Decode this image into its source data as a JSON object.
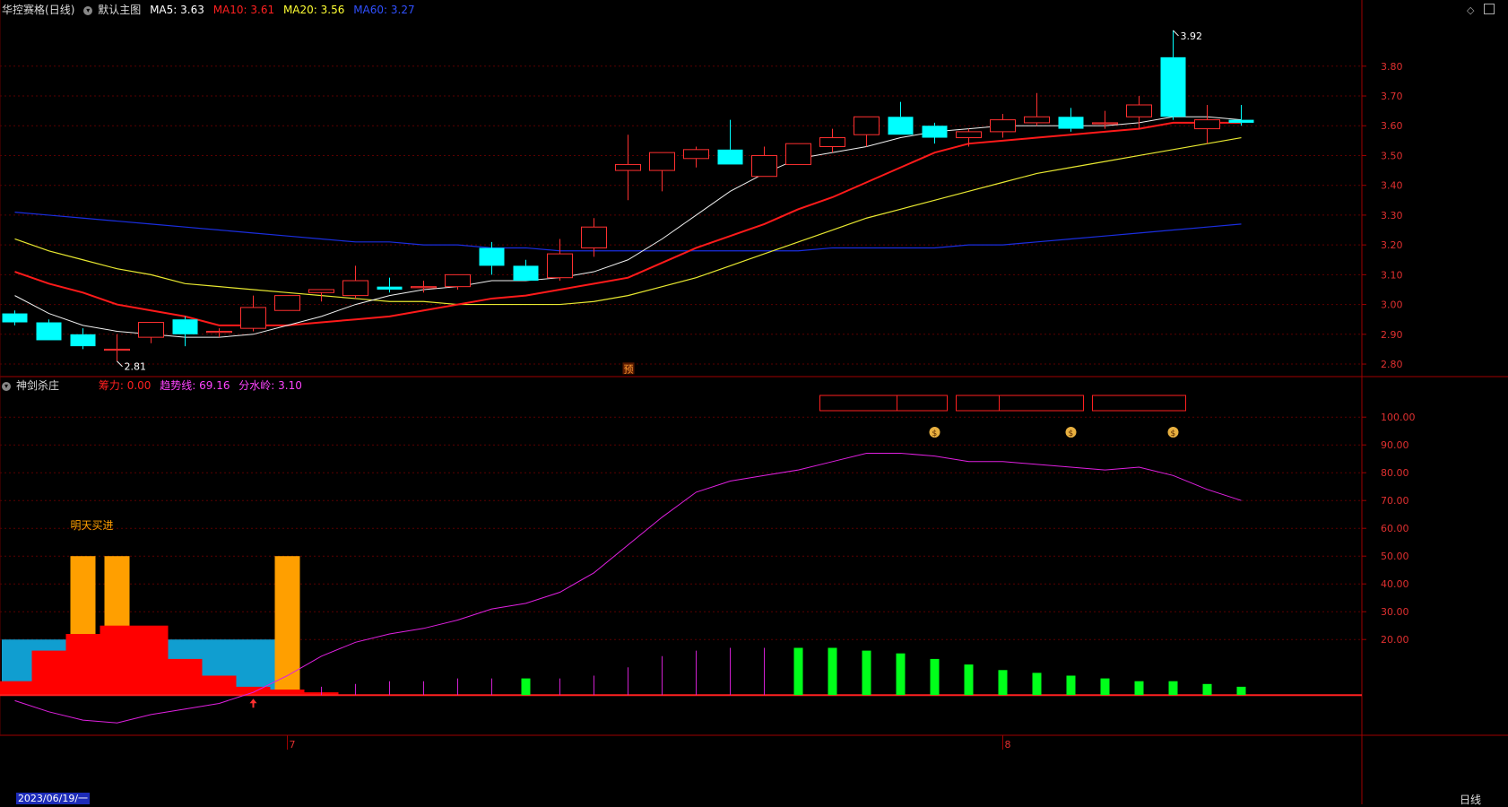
{
  "header": {
    "stock_name": "华控赛格",
    "period": "(日线)",
    "main_chart_label": "默认主图",
    "ma": [
      {
        "label": "MA5:",
        "value": "3.63",
        "color": "#ffffff"
      },
      {
        "label": "MA10:",
        "value": "3.61",
        "color": "#ff2020"
      },
      {
        "label": "MA20:",
        "value": "3.56",
        "color": "#ffff33"
      },
      {
        "label": "MA60:",
        "value": "3.27",
        "color": "#3050ff"
      }
    ]
  },
  "indicator_header": {
    "name": "神剑杀庄",
    "items": [
      {
        "text": "筹力: 0.00",
        "color": "#ff2020"
      },
      {
        "text": "趋势线: 69.16",
        "color": "#ff44ff"
      },
      {
        "text": "分水岭: 3.10",
        "color": "#ff44ff"
      }
    ]
  },
  "footer": {
    "date": "2023/06/19/一",
    "period_button": "日线",
    "month_marks": [
      "7",
      "8"
    ]
  },
  "chart_data": [
    {
      "type": "candlestick",
      "ylim": [
        2.77,
        3.98
      ],
      "y_ticks": [
        "3.80",
        "3.70",
        "3.60",
        "3.50",
        "3.40",
        "3.30",
        "3.20",
        "3.10",
        "3.00",
        "2.90",
        "2.80"
      ],
      "candles": [
        {
          "o": 2.97,
          "h": 2.98,
          "l": 2.93,
          "c": 2.94
        },
        {
          "o": 2.94,
          "h": 2.95,
          "l": 2.88,
          "c": 2.88
        },
        {
          "o": 2.9,
          "h": 2.92,
          "l": 2.85,
          "c": 2.86
        },
        {
          "o": 2.85,
          "h": 2.9,
          "l": 2.81,
          "c": 2.85
        },
        {
          "o": 2.89,
          "h": 2.94,
          "l": 2.87,
          "c": 2.94
        },
        {
          "o": 2.95,
          "h": 2.96,
          "l": 2.86,
          "c": 2.9
        },
        {
          "o": 2.91,
          "h": 2.92,
          "l": 2.89,
          "c": 2.91
        },
        {
          "o": 2.92,
          "h": 3.03,
          "l": 2.91,
          "c": 2.99
        },
        {
          "o": 2.98,
          "h": 3.03,
          "l": 2.98,
          "c": 3.03
        },
        {
          "o": 3.04,
          "h": 3.05,
          "l": 3.01,
          "c": 3.05
        },
        {
          "o": 3.03,
          "h": 3.13,
          "l": 3.02,
          "c": 3.08
        },
        {
          "o": 3.06,
          "h": 3.09,
          "l": 3.04,
          "c": 3.05
        },
        {
          "o": 3.06,
          "h": 3.08,
          "l": 3.04,
          "c": 3.06
        },
        {
          "o": 3.06,
          "h": 3.1,
          "l": 3.05,
          "c": 3.1
        },
        {
          "o": 3.19,
          "h": 3.21,
          "l": 3.1,
          "c": 3.13
        },
        {
          "o": 3.13,
          "h": 3.15,
          "l": 3.08,
          "c": 3.08
        },
        {
          "o": 3.09,
          "h": 3.22,
          "l": 3.08,
          "c": 3.17
        },
        {
          "o": 3.19,
          "h": 3.29,
          "l": 3.16,
          "c": 3.26
        },
        {
          "o": 3.45,
          "h": 3.57,
          "l": 3.35,
          "c": 3.47
        },
        {
          "o": 3.45,
          "h": 3.51,
          "l": 3.38,
          "c": 3.51
        },
        {
          "o": 3.49,
          "h": 3.53,
          "l": 3.46,
          "c": 3.52
        },
        {
          "o": 3.52,
          "h": 3.62,
          "l": 3.47,
          "c": 3.47
        },
        {
          "o": 3.43,
          "h": 3.53,
          "l": 3.43,
          "c": 3.5
        },
        {
          "o": 3.47,
          "h": 3.54,
          "l": 3.47,
          "c": 3.54
        },
        {
          "o": 3.53,
          "h": 3.59,
          "l": 3.51,
          "c": 3.56
        },
        {
          "o": 3.57,
          "h": 3.63,
          "l": 3.53,
          "c": 3.63
        },
        {
          "o": 3.63,
          "h": 3.68,
          "l": 3.57,
          "c": 3.57
        },
        {
          "o": 3.6,
          "h": 3.61,
          "l": 3.54,
          "c": 3.56
        },
        {
          "o": 3.56,
          "h": 3.59,
          "l": 3.53,
          "c": 3.58
        },
        {
          "o": 3.58,
          "h": 3.64,
          "l": 3.56,
          "c": 3.62
        },
        {
          "o": 3.61,
          "h": 3.71,
          "l": 3.6,
          "c": 3.63
        },
        {
          "o": 3.63,
          "h": 3.66,
          "l": 3.58,
          "c": 3.59
        },
        {
          "o": 3.61,
          "h": 3.65,
          "l": 3.59,
          "c": 3.61
        },
        {
          "o": 3.63,
          "h": 3.7,
          "l": 3.59,
          "c": 3.67
        },
        {
          "o": 3.83,
          "h": 3.92,
          "l": 3.62,
          "c": 3.63
        },
        {
          "o": 3.59,
          "h": 3.67,
          "l": 3.54,
          "c": 3.62
        },
        {
          "o": 3.62,
          "h": 3.67,
          "l": 3.6,
          "c": 3.61
        }
      ],
      "ma5": [
        3.03,
        2.97,
        2.93,
        2.91,
        2.9,
        2.89,
        2.89,
        2.9,
        2.93,
        2.96,
        3.0,
        3.03,
        3.05,
        3.06,
        3.08,
        3.08,
        3.09,
        3.11,
        3.15,
        3.22,
        3.3,
        3.38,
        3.44,
        3.49,
        3.51,
        3.53,
        3.56,
        3.58,
        3.59,
        3.6,
        3.6,
        3.6,
        3.6,
        3.61,
        3.63,
        3.63,
        3.62
      ],
      "ma10": [
        3.11,
        3.07,
        3.04,
        3.0,
        2.98,
        2.96,
        2.93,
        2.93,
        2.93,
        2.94,
        2.95,
        2.96,
        2.98,
        3.0,
        3.02,
        3.03,
        3.05,
        3.07,
        3.09,
        3.14,
        3.19,
        3.23,
        3.27,
        3.32,
        3.36,
        3.41,
        3.46,
        3.51,
        3.54,
        3.55,
        3.56,
        3.57,
        3.58,
        3.59,
        3.61,
        3.61,
        3.61
      ],
      "ma20": [
        3.22,
        3.18,
        3.15,
        3.12,
        3.1,
        3.07,
        3.06,
        3.05,
        3.04,
        3.03,
        3.02,
        3.01,
        3.01,
        3.0,
        3.0,
        3.0,
        3.0,
        3.01,
        3.03,
        3.06,
        3.09,
        3.13,
        3.17,
        3.21,
        3.25,
        3.29,
        3.32,
        3.35,
        3.38,
        3.41,
        3.44,
        3.46,
        3.48,
        3.5,
        3.52,
        3.54,
        3.56
      ],
      "ma60": [
        3.31,
        3.3,
        3.29,
        3.28,
        3.27,
        3.26,
        3.25,
        3.24,
        3.23,
        3.22,
        3.21,
        3.21,
        3.2,
        3.2,
        3.19,
        3.19,
        3.18,
        3.18,
        3.18,
        3.18,
        3.18,
        3.18,
        3.18,
        3.18,
        3.19,
        3.19,
        3.19,
        3.19,
        3.2,
        3.2,
        3.21,
        3.22,
        3.23,
        3.24,
        3.25,
        3.26,
        3.27
      ],
      "annotations": [
        {
          "text": "3.92",
          "index": 34,
          "price": 3.92
        },
        {
          "text": "2.81",
          "index": 3,
          "price": 2.81
        },
        {
          "text": "预",
          "index": 18,
          "price": 2.79
        }
      ]
    },
    {
      "type": "indicator",
      "ylim": [
        -8,
        112
      ],
      "y_ticks": [
        "100.00",
        "90.00",
        "80.00",
        "70.00",
        "60.00",
        "50.00",
        "40.00",
        "30.00",
        "20.00"
      ],
      "trend_line": [
        -2,
        -6,
        -9,
        -10,
        -7,
        -5,
        -3,
        1,
        7,
        14,
        19,
        22,
        24,
        27,
        31,
        33,
        37,
        44,
        54,
        64,
        73,
        77,
        79,
        81,
        84,
        87,
        87,
        86,
        84,
        84,
        83,
        82,
        81,
        82,
        79,
        74,
        70
      ],
      "green_bars": [
        {
          "index": 15,
          "value": 6
        },
        {
          "index": 23,
          "value": 17
        },
        {
          "index": 24,
          "value": 17
        },
        {
          "index": 25,
          "value": 16
        },
        {
          "index": 26,
          "value": 15
        },
        {
          "index": 27,
          "value": 13
        },
        {
          "index": 28,
          "value": 11
        },
        {
          "index": 29,
          "value": 9
        },
        {
          "index": 30,
          "value": 8
        },
        {
          "index": 31,
          "value": 7
        },
        {
          "index": 32,
          "value": 6
        },
        {
          "index": 33,
          "value": 5
        },
        {
          "index": 34,
          "value": 5
        },
        {
          "index": 35,
          "value": 4
        },
        {
          "index": 36,
          "value": 3
        }
      ],
      "magenta_lines": [
        {
          "index": 9,
          "value": 3
        },
        {
          "index": 10,
          "value": 4
        },
        {
          "index": 11,
          "value": 5
        },
        {
          "index": 12,
          "value": 5
        },
        {
          "index": 13,
          "value": 6
        },
        {
          "index": 14,
          "value": 6
        },
        {
          "index": 16,
          "value": 6
        },
        {
          "index": 17,
          "value": 7
        },
        {
          "index": 18,
          "value": 10
        },
        {
          "index": 19,
          "value": 14
        },
        {
          "index": 20,
          "value": 16
        },
        {
          "index": 21,
          "value": 17
        },
        {
          "index": 22,
          "value": 17
        }
      ],
      "orange_bars": [
        {
          "index": 2,
          "value": 50
        },
        {
          "index": 3,
          "value": 50
        },
        {
          "index": 8,
          "value": 50
        }
      ],
      "blue_area": [
        20,
        20,
        20,
        20,
        20,
        20,
        20,
        20,
        20
      ],
      "red_area": [
        5,
        16,
        22,
        25,
        25,
        13,
        7,
        3,
        2,
        1
      ],
      "buy_text": "明天买进",
      "money_icons": [
        27,
        31,
        34
      ]
    }
  ]
}
